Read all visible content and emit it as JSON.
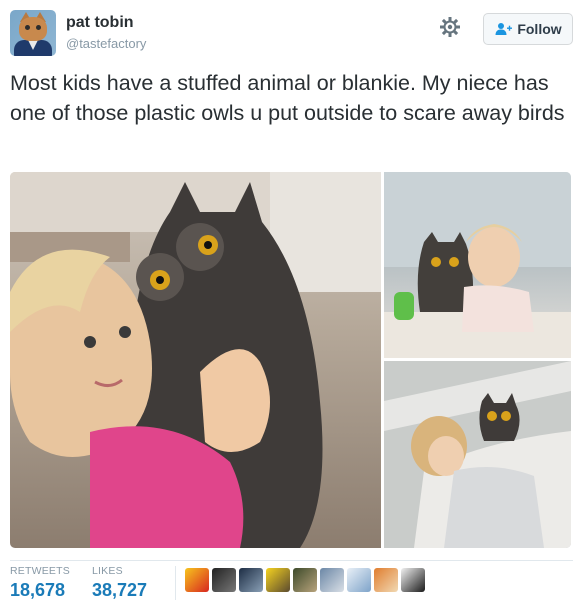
{
  "user": {
    "name": "pat tobin",
    "handle": "@tastefactory",
    "avatar_icon": "cat-avatar-icon"
  },
  "actions": {
    "settings_icon": "gear-icon",
    "follow_label": "Follow",
    "follow_icon": "add-user-icon"
  },
  "tweet": {
    "text": "Most kids have a stuffed animal or blankie. My niece has one of those plastic owls u put outside to scare away birds"
  },
  "media": {
    "photo_count": 3
  },
  "stats": {
    "retweets_label": "RETWEETS",
    "retweets_value": "18,678",
    "likes_label": "LIKES",
    "likes_value": "38,727"
  },
  "likers": {
    "count": 9
  },
  "colors": {
    "accent": "#1a7bb8",
    "muted": "#8899a6",
    "text": "#292f33"
  }
}
